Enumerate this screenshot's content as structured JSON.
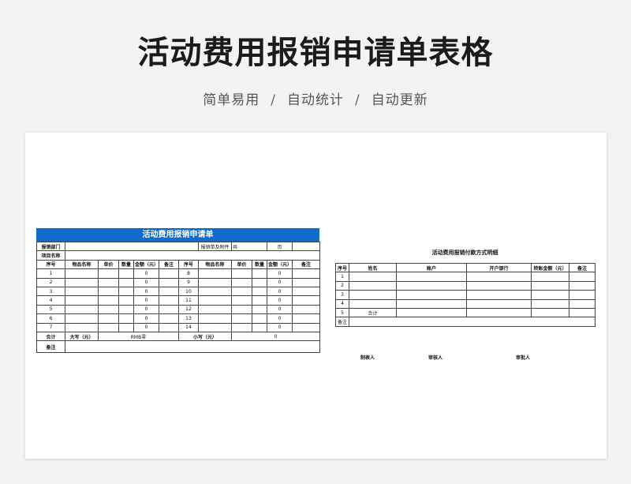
{
  "header": {
    "title": "活动费用报销申请单表格",
    "subtitle_parts": [
      "简单易用",
      "自动统计",
      "自动更新"
    ],
    "separator": "/"
  },
  "form": {
    "title": "活动费用报销申请单",
    "dept_label": "报销部门",
    "attach_label": "报销单及附件",
    "attach_total": "共",
    "attach_pages": "页",
    "project_label": "项目名称",
    "columns": [
      "序号",
      "物品名称",
      "单价",
      "数量",
      "金额（元）",
      "备注"
    ],
    "left_rows": [
      {
        "no": "1",
        "amount": "0"
      },
      {
        "no": "2",
        "amount": "0"
      },
      {
        "no": "3",
        "amount": "0"
      },
      {
        "no": "4",
        "amount": "0"
      },
      {
        "no": "5",
        "amount": "0"
      },
      {
        "no": "6",
        "amount": "0"
      },
      {
        "no": "7",
        "amount": "0"
      }
    ],
    "right_rows": [
      {
        "no": "8",
        "amount": "0"
      },
      {
        "no": "9",
        "amount": "0"
      },
      {
        "no": "10",
        "amount": "0"
      },
      {
        "no": "11",
        "amount": "0"
      },
      {
        "no": "12",
        "amount": "0"
      },
      {
        "no": "13",
        "amount": "0"
      },
      {
        "no": "14",
        "amount": "0"
      }
    ],
    "total_label": "合计",
    "upper_label": "大写（元）",
    "upper_value": "RMB零",
    "lower_label": "小写（元）",
    "lower_value": "0",
    "remark_label": "备注"
  },
  "payment": {
    "title": "活动费用报销付款方式明细",
    "columns": [
      "序号",
      "姓名",
      "账户",
      "开户银行",
      "转账金额（元）",
      "备注"
    ],
    "rows": [
      "1",
      "2",
      "3",
      "4"
    ],
    "total_no": "5",
    "total_label": "合计",
    "remark_label": "备注",
    "signatures": [
      "制表人",
      "审核人",
      "审批人"
    ]
  }
}
